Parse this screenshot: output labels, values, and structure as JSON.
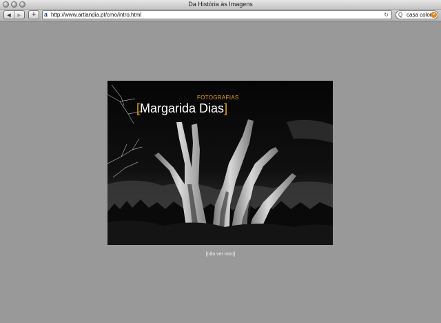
{
  "window": {
    "title": "Da História às Imagens"
  },
  "toolbar": {
    "back_icon": "◀",
    "forward_icon": "▶",
    "add_label": "+",
    "url": "http://www.artlandia.pt/cmo/intro.html",
    "site_icon": "a",
    "reload_icon": "↻",
    "search_icon": "Q",
    "search_value": "casa color",
    "clear_icon": "⊗"
  },
  "intro": {
    "subtitle": "FOTOGRAFIAS",
    "bracket_open": "[",
    "name": "Margarida Dias",
    "bracket_close": "]"
  },
  "skip_link": "[não ver intro]",
  "colors": {
    "accent": "#e7a21a",
    "page_bg": "#999999"
  }
}
